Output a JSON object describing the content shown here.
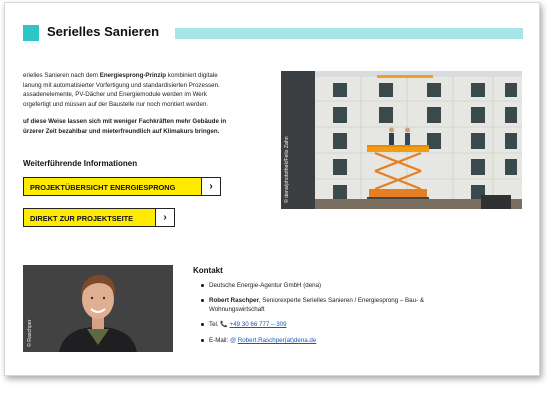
{
  "header": {
    "title": "Serielles Sanieren"
  },
  "intro": {
    "p1_line1_a": "erielles Sanieren nach dem ",
    "p1_line1_b": "Energiesprong-Prinzip",
    "p1_line1_c": " kombiniert digitale",
    "p1_line2": "lanung mit automatisierter Vorfertigung und standardisierten Prozessen.",
    "p1_line3": "assadenelemente, PV-Dächer und Energiemodule werden im Werk",
    "p1_line4": "orgefertigt und müssen auf der Baustelle nur noch montiert werden.",
    "p2_line1": "uf diese Weise lassen sich mit weniger Fachkräften mehr Gebäude in",
    "p2_line2": "ürzerer Zeit bezahlbar und mieterfreundlich auf Klimakurs bringen."
  },
  "further": {
    "heading": "Weiterführende Informationen"
  },
  "buttons": {
    "overview": "PROJEKTÜBERSICHT ENERGIESPRONG",
    "project": "DIREKT ZUR PROJEKTSEITE",
    "arrow": "›"
  },
  "photo_building": {
    "credit": "© dena/photothek/Felix Zahn"
  },
  "photo_person": {
    "credit": "© Raschper"
  },
  "kontakt": {
    "title": "Kontakt",
    "org": "Deutsche Energie-Agentur GmbH (dena)",
    "person_name": "Robert Raschper",
    "person_role_1": ", Seniorexperte Serielles Sanieren / Energiesprong – Bau- &",
    "person_role_2": "Wohnungswirtschaft",
    "tel_label": "Tel.",
    "tel_icon": "📞",
    "tel": "+49 30 66 777 – 309",
    "email_label": "E-Mail:",
    "email_icon": "@",
    "email": "Robert.Raschper(at)dena.de"
  },
  "colors": {
    "accent_teal": "#2cc6c6",
    "accent_bar": "#a6e6e8",
    "button_yellow": "#ffeb00",
    "link": "#1a56b8"
  }
}
